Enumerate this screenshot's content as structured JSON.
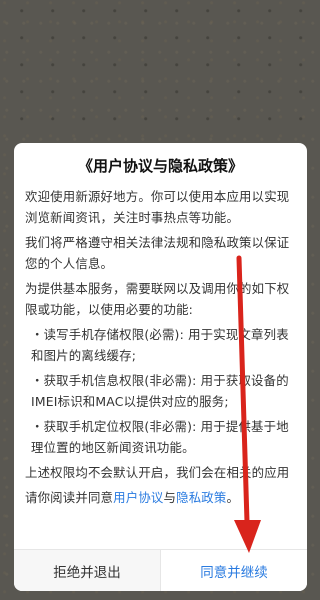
{
  "dialog": {
    "title": "《用户协议与隐私政策》",
    "paragraphs": [
      "欢迎使用新源好地方。你可以使用本应用以实现浏览新闻资讯，关注时事热点等功能。",
      "我们将严格遵守相关法律法规和隐私政策以保证您的个人信息。",
      "为提供基本服务，需要联网以及调用你的如下权限或功能，以使用必要的功能:",
      "・读写手机存储权限(必需): 用于实现文章列表和图片的离线缓存;",
      "・获取手机信息权限(非必需): 用于获取设备的IMEI标识和MAC以提供对应的服务;",
      "・获取手机定位权限(非必需): 用于提供基于地理位置的地区新闻资讯功能。",
      "上述权限均不会默认开启，我们会在相关的应用"
    ],
    "consent_prefix": "请你阅读并同意",
    "user_agreement_link": "用户协议",
    "and_text": "与",
    "privacy_policy_link": "隐私政策",
    "consent_suffix": "。",
    "decline_label": "拒绝并退出",
    "agree_label": "同意并继续"
  },
  "colors": {
    "accent": "#2a7be0",
    "annotation_arrow": "#d9241c"
  }
}
